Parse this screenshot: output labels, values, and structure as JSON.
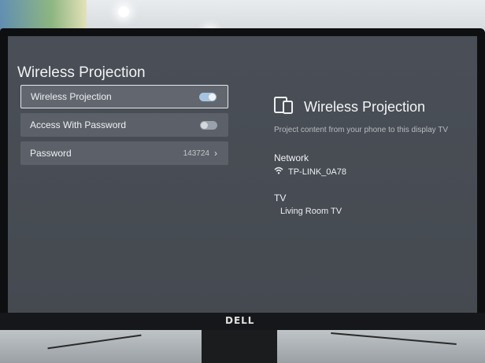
{
  "settings": {
    "page_title": "Wireless Projection",
    "rows": [
      {
        "label": "Wireless Projection",
        "toggle": "on"
      },
      {
        "label": "Access With Password",
        "toggle": "off"
      },
      {
        "label": "Password",
        "value": "143724"
      }
    ]
  },
  "info_panel": {
    "icon": "devices-icon",
    "title": "Wireless Projection",
    "description": "Project content from your phone to this display TV",
    "network_label": "Network",
    "network_icon": "wifi-icon",
    "network_value": "TP-LINK_0A78",
    "tv_label": "TV",
    "tv_value": "Living Room TV"
  },
  "monitor": {
    "brand": "DELL"
  },
  "colors": {
    "screen_bg": "#474c53",
    "row_bg": "#5c6169",
    "toggle_on": "#a5c3e0"
  }
}
